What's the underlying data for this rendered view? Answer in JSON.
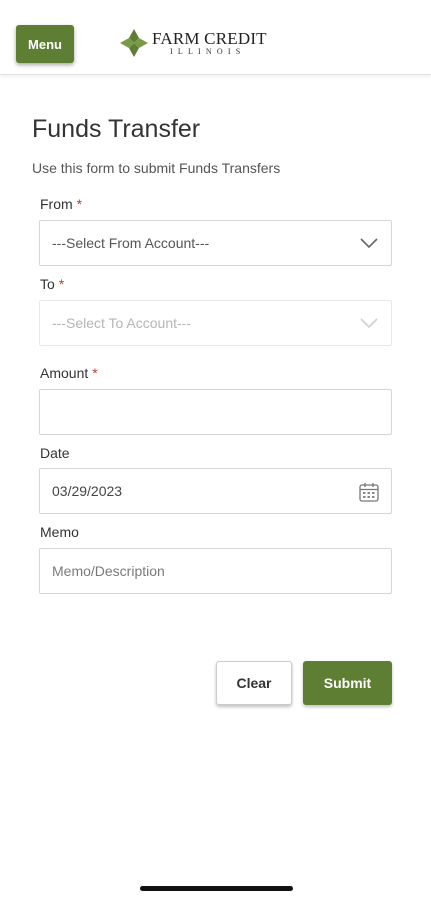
{
  "header": {
    "menu_label": "Menu",
    "logo_name": "FARM CREDIT",
    "logo_sub": "ILLINOIS",
    "brand_color": "#5e7f33"
  },
  "page": {
    "title": "Funds Transfer",
    "subtitle": "Use this form to submit Funds Transfers"
  },
  "form": {
    "from": {
      "label": "From",
      "required_mark": "*",
      "value": "---Select From Account---"
    },
    "to": {
      "label": "To",
      "required_mark": "*",
      "value": "---Select To Account---"
    },
    "amount": {
      "label": "Amount",
      "required_mark": "*",
      "value": ""
    },
    "date": {
      "label": "Date",
      "value": "03/29/2023"
    },
    "memo": {
      "label": "Memo",
      "placeholder": "Memo/Description",
      "value": ""
    }
  },
  "actions": {
    "clear_label": "Clear",
    "submit_label": "Submit"
  }
}
